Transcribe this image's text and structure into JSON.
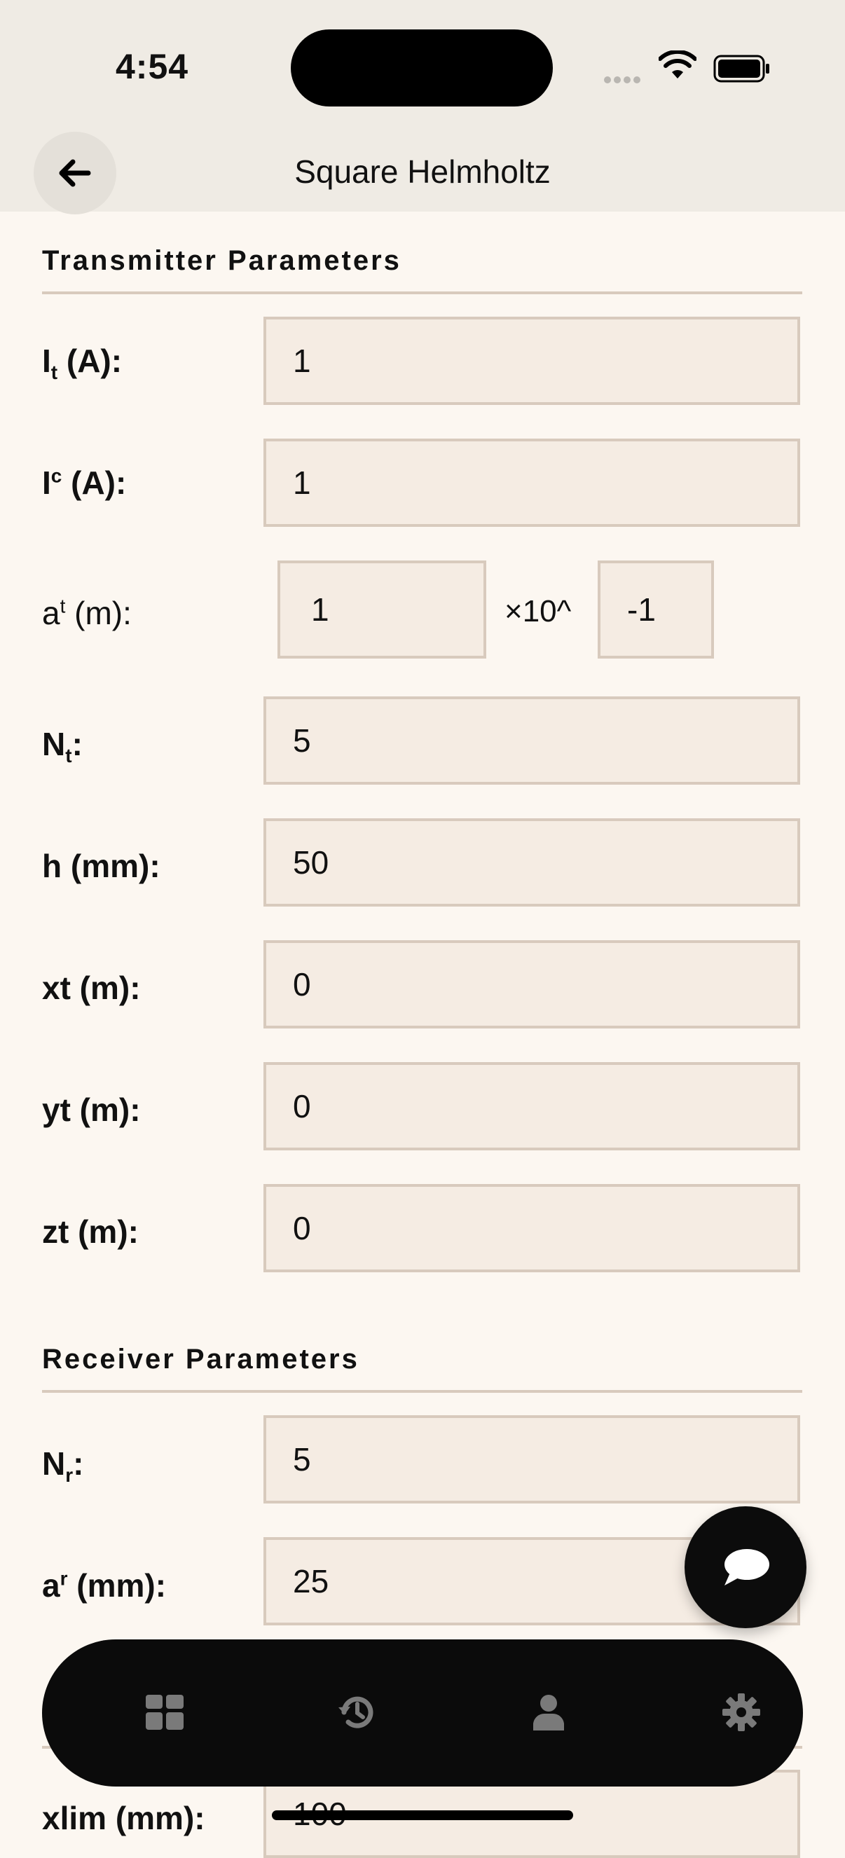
{
  "status": {
    "time": "4:54"
  },
  "nav": {
    "title": "Square Helmholtz"
  },
  "transmitter": {
    "section_title": "Transmitter Parameters",
    "it_label": "I",
    "it_sub": "t",
    "it_unit": " (A):",
    "it_value": "1",
    "ic_label": "I",
    "ic_sup": "c",
    "ic_unit": " (A):",
    "ic_value": "1",
    "at_label": "a",
    "at_sup": "t",
    "at_unit": " (m):",
    "at_mantissa": "1",
    "at_times": "×10^",
    "at_exponent": "-1",
    "nt_label": "N",
    "nt_sub": "t",
    "nt_unit": ":",
    "nt_value": "5",
    "h_label": "h (mm):",
    "h_value": "50",
    "xt_label": "xt (m):",
    "xt_value": "0",
    "yt_label": "yt (m):",
    "yt_value": "0",
    "zt_label": "zt (m):",
    "zt_value": "0"
  },
  "receiver": {
    "section_title": "Receiver Parameters",
    "nr_label": "N",
    "nr_sub": "r",
    "nr_unit": ":",
    "nr_value": "5",
    "ar_label": "a",
    "ar_sup": "r",
    "ar_unit": " (mm):",
    "ar_value": "25",
    "xlim_label": "xlim (mm):",
    "xlim_value": "100"
  },
  "tabs": [
    {
      "icon": "dashboard-icon"
    },
    {
      "icon": "history-icon"
    },
    {
      "icon": "user-icon"
    },
    {
      "icon": "gear-icon"
    }
  ]
}
